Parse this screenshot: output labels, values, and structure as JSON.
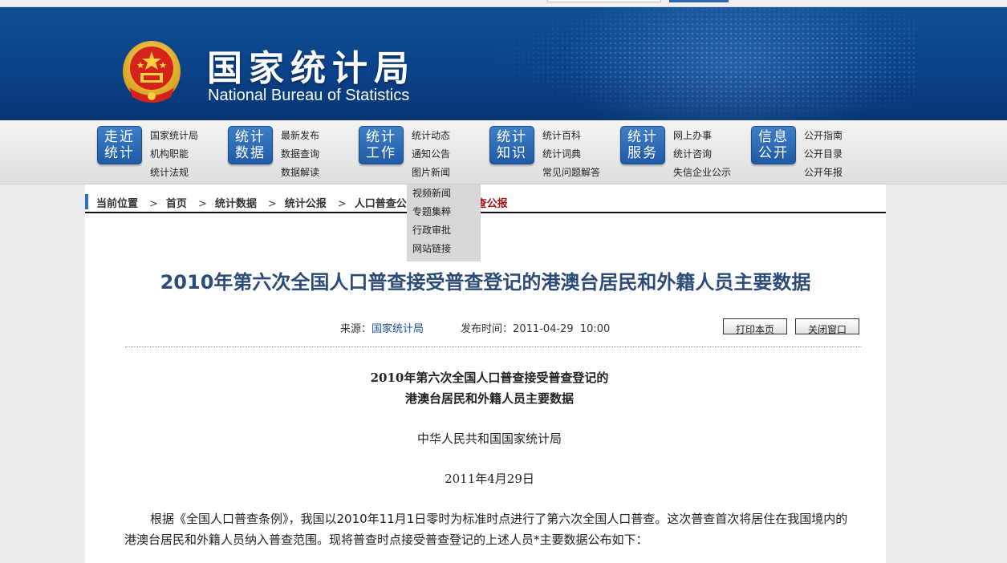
{
  "header": {
    "title_cn": "国家统计局",
    "title_en": "National Bureau of Statistics"
  },
  "nav": [
    {
      "badge": [
        "走近",
        "统计"
      ],
      "links": [
        "国家统计局",
        "机构职能",
        "统计法规"
      ]
    },
    {
      "badge": [
        "统计",
        "数据"
      ],
      "links": [
        "最新发布",
        "数据查询",
        "数据解读"
      ]
    },
    {
      "badge": [
        "统计",
        "工作"
      ],
      "links": [
        "统计动态",
        "通知公告",
        "图片新闻"
      ]
    },
    {
      "badge": [
        "统计",
        "知识"
      ],
      "links": [
        "统计百科",
        "统计词典",
        "常见问题解答"
      ]
    },
    {
      "badge": [
        "统计",
        "服务"
      ],
      "links": [
        "网上办事",
        "统计咨询",
        "失信企业公示"
      ]
    },
    {
      "badge": [
        "信息",
        "公开"
      ],
      "links": [
        "公开指南",
        "公开目录",
        "公开年报"
      ]
    }
  ],
  "dropdown": [
    "视频新闻",
    "专题集粹",
    "行政审批",
    "网站链接"
  ],
  "breadcrumb": {
    "label": "当前位置",
    "items": [
      "首页",
      "统计数据",
      "统计公报",
      "人口普查公报",
      "人口普查公报"
    ]
  },
  "article": {
    "title": "2010年第六次全国人口普查接受普查登记的港澳台居民和外籍人员主要数据",
    "source_label": "来源：",
    "source": "国家统计局",
    "time_label": "发布时间：",
    "time": "2011-04-29  10:00",
    "print_label": "打印本页",
    "close_label": "关闭窗口",
    "subtitle_1": "2010年第六次全国人口普查接受普查登记的",
    "subtitle_2": "港澳台居民和外籍人员主要数据",
    "org": "中华人民共和国国家统计局",
    "date": "2011年4月29日",
    "para": "根据《全国人口普查条例》，我国以2010年11月1日零时为标准时点进行了第六次全国人口普查。这次普查首次将居住在我国境内的港澳台居民和外籍人员纳入普查范围。现将普查时点接受普查登记的上述人员*主要数据公布如下："
  }
}
